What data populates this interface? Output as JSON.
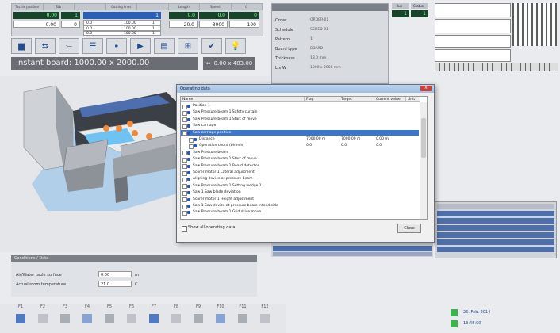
{
  "top_panel": {
    "headers": [
      "Tactile position",
      "Tab",
      "",
      "Cutting lines",
      "",
      "Length",
      "Speed",
      "Q"
    ],
    "row1": {
      "a": "0.00",
      "b": "1",
      "c": "0.0",
      "d": "1",
      "e": "0.0",
      "f": "0"
    },
    "row2": {
      "a": "0.00",
      "b": "0",
      "l1": "0.0",
      "l1v": "100.00",
      "l1n": "1",
      "e": "20.0",
      "f": "3000",
      "g": "100"
    },
    "row3": {
      "l2": "0.0",
      "l2v": "100.00",
      "l2n": "1"
    },
    "row4": {
      "l3": "0.0",
      "l3v": "100.00",
      "l3n": "1"
    }
  },
  "banner": {
    "text": "Instant board: 1000.00 x 2000.00",
    "right": "0.00 x 483.00"
  },
  "info": {
    "labels": [
      "Order",
      "Schedule",
      "Pattern",
      "Board type",
      "Thickness",
      "L x W"
    ],
    "values": [
      "ORDER-01",
      "SCHED-01",
      "1",
      "BOARD",
      "18.0 mm",
      "1000 x 2000 mm"
    ]
  },
  "right_cells": {
    "h1": "Run",
    "h2": "Status",
    "v1": "1",
    "v2": "1"
  },
  "dialog": {
    "title": "Operating data",
    "close": "X",
    "columns": [
      "Name",
      "Flag",
      "Target",
      "Current value",
      "Unit"
    ],
    "rows": [
      {
        "t": "Position 1",
        "lvl": 1
      },
      {
        "t": "Saw Pressure beam 1 Safety curtain",
        "lvl": 1
      },
      {
        "t": "Saw Pressure beam 1 Start of move",
        "lvl": 1
      },
      {
        "t": "Saw carriage",
        "lvl": 1
      },
      {
        "t": "Saw carriage position",
        "lvl": 1,
        "sel": true
      },
      {
        "t": "Distance",
        "lvl": 2,
        "flag": "7000.00 m",
        "target": "7000.00 m",
        "cur": "0.00 m"
      },
      {
        "t": "Operation count (bh min)",
        "lvl": 2,
        "flag": "0.0",
        "target": "0.0",
        "cur": "0.0"
      },
      {
        "t": "Saw Pressure beam",
        "lvl": 1
      },
      {
        "t": "Saw Pressure beam 1 Start of move",
        "lvl": 1
      },
      {
        "t": "Saw Pressure beam 1 Board detector",
        "lvl": 1
      },
      {
        "t": "Scorer motor 1 Lateral adjustment",
        "lvl": 1
      },
      {
        "t": "Aligning device at pressure beam",
        "lvl": 1
      },
      {
        "t": "Saw Pressure beam 1 Setting wedge 1",
        "lvl": 1
      },
      {
        "t": "Saw 1 Saw blade deviation",
        "lvl": 1
      },
      {
        "t": "Scorer motor 1 Height adjustment",
        "lvl": 1
      },
      {
        "t": "Saw 1 Saw device at pressure beam Infeed side",
        "lvl": 1
      },
      {
        "t": "Saw Pressure beam 1 Grid drive move",
        "lvl": 1
      }
    ],
    "show_all": "Show all operating data",
    "close_button": "Close"
  },
  "bottom_panel": {
    "title": "Conditions / Data",
    "f1_label": "Air/Water table surface",
    "f1_val": "0.00",
    "f1_unit": "m",
    "f2_label": "Actual room temperature",
    "f2_val": "21.0",
    "f2_unit": "C"
  },
  "bottom_toolbar": [
    "F1",
    "F2",
    "F3",
    "F4",
    "F5",
    "F6",
    "F7",
    "F8",
    "F9",
    "F10",
    "F11",
    "F12"
  ],
  "status": {
    "line1": "26. Feb. 2014",
    "line2": "13:45:00"
  },
  "colors": {
    "accent_blue": "#2a5fb8",
    "display_green": "#17452a",
    "selection": "#3a76d0"
  }
}
